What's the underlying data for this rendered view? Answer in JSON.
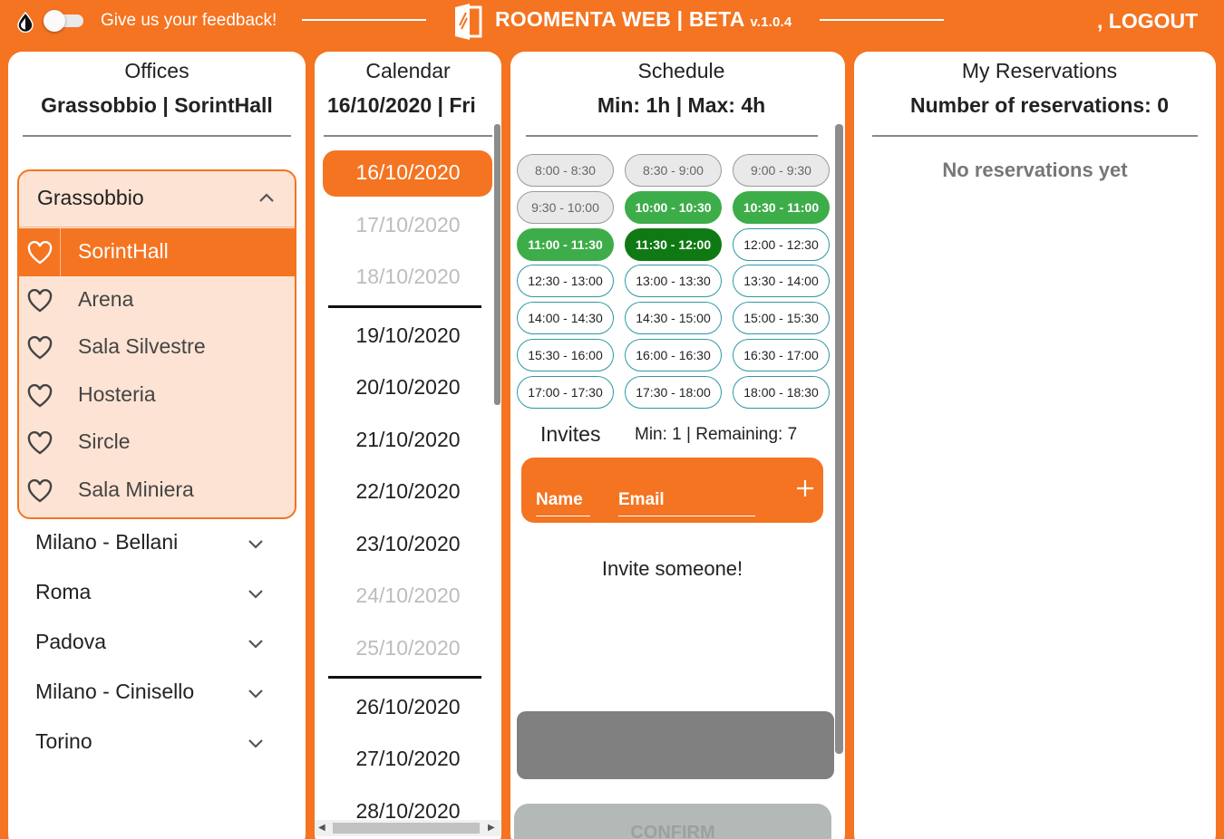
{
  "header": {
    "feedback_label": "Give us your feedback!",
    "app_title": "ROOMENTA WEB | BETA",
    "version": "v.1.0.4",
    "logout_label": ", LOGOUT",
    "accent_color": "#f47421"
  },
  "offices": {
    "title": "Offices",
    "selected": "Grassobbio | SorintHall",
    "expanded_group": {
      "label": "Grassobbio",
      "rooms": [
        {
          "label": "SorintHall",
          "selected": true
        },
        {
          "label": "Arena",
          "selected": false
        },
        {
          "label": "Sala Silvestre",
          "selected": false
        },
        {
          "label": "Hosteria",
          "selected": false
        },
        {
          "label": "Sircle",
          "selected": false
        },
        {
          "label": "Sala Miniera",
          "selected": false
        }
      ]
    },
    "collapsed_groups": [
      {
        "label": "Milano - Bellani"
      },
      {
        "label": "Roma"
      },
      {
        "label": "Padova"
      },
      {
        "label": "Milano - Cinisello"
      },
      {
        "label": "Torino"
      }
    ]
  },
  "calendar": {
    "title": "Calendar",
    "selected": "16/10/2020 | Fri",
    "dates": [
      {
        "label": "16/10/2020",
        "state": "selected"
      },
      {
        "label": "17/10/2020",
        "state": "disabled"
      },
      {
        "label": "18/10/2020",
        "state": "disabled"
      },
      {
        "label": "19/10/2020",
        "state": "normal"
      },
      {
        "label": "20/10/2020",
        "state": "normal"
      },
      {
        "label": "21/10/2020",
        "state": "normal"
      },
      {
        "label": "22/10/2020",
        "state": "normal"
      },
      {
        "label": "23/10/2020",
        "state": "normal"
      },
      {
        "label": "24/10/2020",
        "state": "disabled"
      },
      {
        "label": "25/10/2020",
        "state": "disabled"
      },
      {
        "label": "26/10/2020",
        "state": "normal"
      },
      {
        "label": "27/10/2020",
        "state": "normal"
      },
      {
        "label": "28/10/2020",
        "state": "normal"
      }
    ]
  },
  "schedule": {
    "title": "Schedule",
    "limits": "Min: 1h | Max: 4h",
    "slots": [
      {
        "label": "8:00 - 8:30",
        "state": "past"
      },
      {
        "label": "8:30 - 9:00",
        "state": "past"
      },
      {
        "label": "9:00 - 9:30",
        "state": "past"
      },
      {
        "label": "9:30 - 10:00",
        "state": "past"
      },
      {
        "label": "10:00 - 10:30",
        "state": "available"
      },
      {
        "label": "10:30 - 11:00",
        "state": "available"
      },
      {
        "label": "11:00 - 11:30",
        "state": "available"
      },
      {
        "label": "11:30 - 12:00",
        "state": "selected"
      },
      {
        "label": "12:00 - 12:30",
        "state": "free"
      },
      {
        "label": "12:30 - 13:00",
        "state": "free"
      },
      {
        "label": "13:00 - 13:30",
        "state": "free"
      },
      {
        "label": "13:30 - 14:00",
        "state": "free"
      },
      {
        "label": "14:00 - 14:30",
        "state": "free"
      },
      {
        "label": "14:30 - 15:00",
        "state": "free"
      },
      {
        "label": "15:00 - 15:30",
        "state": "free"
      },
      {
        "label": "15:30 - 16:00",
        "state": "free"
      },
      {
        "label": "16:00 - 16:30",
        "state": "free"
      },
      {
        "label": "16:30 - 17:00",
        "state": "free"
      },
      {
        "label": "17:00 - 17:30",
        "state": "free"
      },
      {
        "label": "17:30 - 18:00",
        "state": "free"
      },
      {
        "label": "18:00 - 18:30",
        "state": "free"
      }
    ],
    "invites_label": "Invites",
    "invites_info": "Min: 1 | Remaining: 7",
    "name_placeholder": "Name",
    "email_placeholder": "Email",
    "empty_invites": "Invite someone!",
    "confirm_label": "CONFIRM"
  },
  "reservations": {
    "title": "My Reservations",
    "count_label": "Number of reservations: 0",
    "empty_label": "No reservations yet"
  }
}
